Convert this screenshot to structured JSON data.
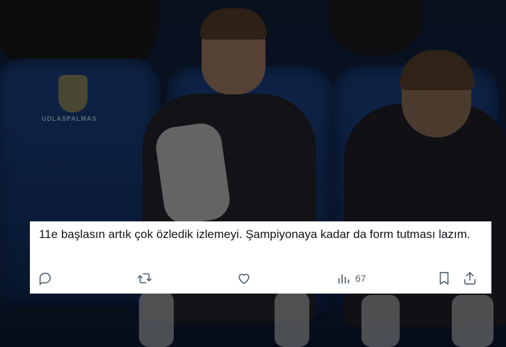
{
  "photo": {
    "seat_branding": "UDLASPALMAS"
  },
  "tweet": {
    "text": "11e başlasın artık çok özledik izlemeyi. Şampiyonaya kadar da form tutması lazım.",
    "actions": {
      "reply_icon": "reply-icon",
      "retweet_icon": "retweet-icon",
      "like_icon": "heart-icon",
      "views_icon": "views-icon",
      "views_count": "67",
      "bookmark_icon": "bookmark-icon",
      "share_icon": "share-icon"
    }
  }
}
